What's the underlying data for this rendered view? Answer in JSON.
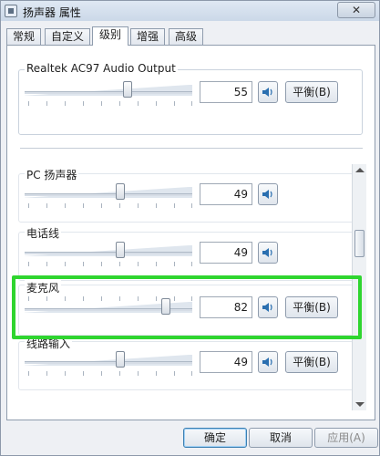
{
  "window": {
    "title": "扬声器 属性",
    "close_label": "✕"
  },
  "tabs": [
    {
      "label": "常规"
    },
    {
      "label": "自定义"
    },
    {
      "label": "级别"
    },
    {
      "label": "增强"
    },
    {
      "label": "高级"
    }
  ],
  "active_tab": "级别",
  "master": {
    "label": "Realtek AC97 Audio Output",
    "value": "55",
    "balance_label": "平衡(B)"
  },
  "channels": [
    {
      "label": "PC 扬声器",
      "value": "49",
      "balance_label": ""
    },
    {
      "label": "电话线",
      "value": "49",
      "balance_label": ""
    },
    {
      "label": "麦克风",
      "value": "82",
      "balance_label": "平衡(B)"
    },
    {
      "label": "线路输入",
      "value": "49",
      "balance_label": "平衡(B)"
    }
  ],
  "buttons": {
    "ok": "确定",
    "cancel": "取消",
    "apply": "应用(A)"
  },
  "colors": {
    "highlight": "#2fd52f",
    "speaker_icon": "#2a6fb0"
  }
}
